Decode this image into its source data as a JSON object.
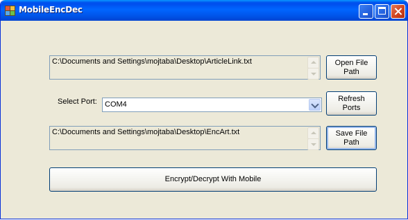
{
  "window": {
    "title": "MobileEncDec"
  },
  "source_file": {
    "path": "C:\\Documents and Settings\\mojtaba\\Desktop\\ArticleLink.txt"
  },
  "buttons": {
    "open_file_path": "Open File Path",
    "refresh_ports": "Refresh Ports",
    "save_file_path": "Save File Path",
    "encrypt_decrypt": "Encrypt/Decrypt With Mobile"
  },
  "port": {
    "label": "Select Port:",
    "selected": "COM4"
  },
  "dest_file": {
    "path": "C:\\Documents and Settings\\mojtaba\\Desktop\\EncArt.txt"
  },
  "icons": [
    "app-icon",
    "minimize-icon",
    "maximize-icon",
    "close-icon",
    "scroll-up-icon",
    "scroll-down-icon",
    "dropdown-arrow-icon"
  ],
  "colors": {
    "titlebar": "#0055ea",
    "window_bg": "#ece9d8",
    "close_button": "#d2451f"
  }
}
